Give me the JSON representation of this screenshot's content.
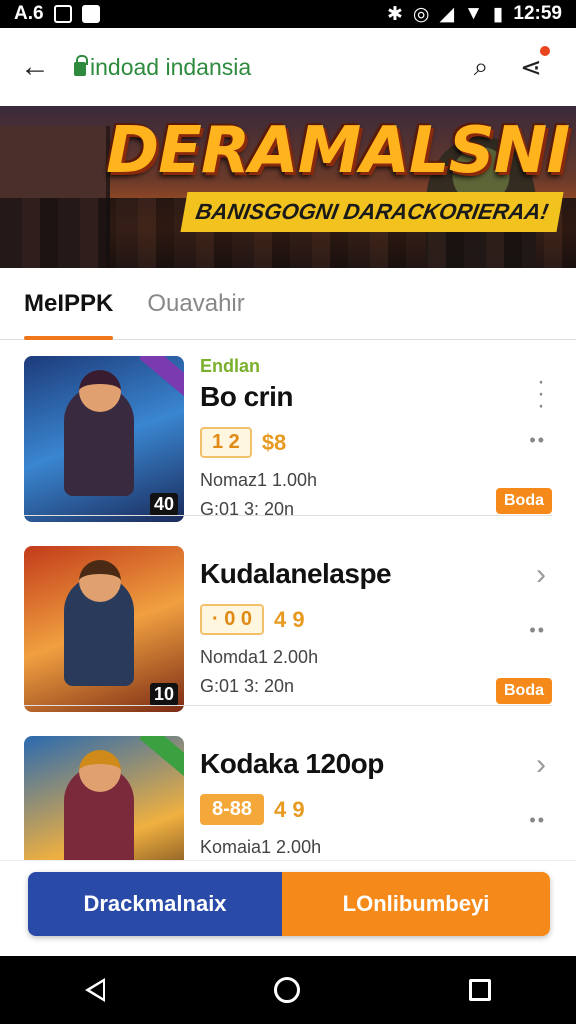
{
  "status_bar": {
    "left_text": "A.6",
    "time": "12:59"
  },
  "app_bar": {
    "url": "indoad indansia"
  },
  "banner": {
    "title": "DERAMALSNI",
    "subtitle": "BANISGOGNI DARACKORIERAA!"
  },
  "tabs": [
    {
      "label": "MeIPPK"
    },
    {
      "label": "Ouavahir"
    }
  ],
  "items": [
    {
      "tag": "Endlan",
      "name": "Bo crin",
      "rating": "1 2",
      "price": "$8",
      "line1": "Nomaz1 1.00h",
      "line2": "G:01 3: 20n",
      "status": "Boda",
      "thumb_badge": "40"
    },
    {
      "tag": "",
      "name": "Kudalanelaspe",
      "rating": "· 0 0",
      "price": "4 9",
      "line1": "Nomda1 2.00h",
      "line2": "G:01 3: 20n",
      "status": "Boda",
      "thumb_badge": "10"
    },
    {
      "tag": "",
      "name": "Kodaka 120op",
      "rating": "8-88",
      "price": "4 9",
      "line1": "Komaia1 2.00h",
      "line2": "",
      "status": "",
      "thumb_badge": ""
    }
  ],
  "buttons": {
    "left": "Drackmalnaix",
    "right": "LOnlibumbeyi"
  },
  "colors": {
    "accent": "#f58a1a",
    "primary": "#2a4aa8",
    "green": "#2e8b3e"
  }
}
